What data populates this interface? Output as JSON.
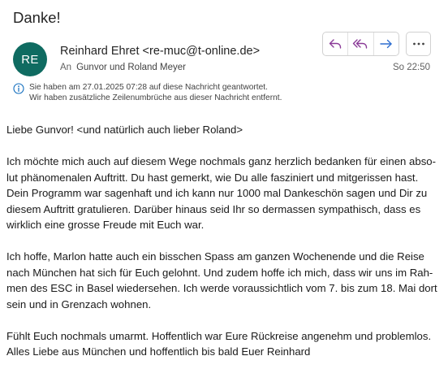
{
  "message": {
    "subject": "Danke!",
    "avatar_initials": "RE",
    "sender": "Reinhard Ehret <re-muc@t-online.de>",
    "to_label": "An",
    "recipients": "Gunvor und Roland Meyer",
    "time": "So 22:50",
    "info_lines": [
      "Sie haben am 27.01.2025 07:28 auf diese Nachricht geantwortet.",
      "Wir haben zusätzliche Zeilenumbrüche aus dieser Nachricht entfernt."
    ],
    "body_lines": [
      "Liebe Gunvor! <und natürlich auch lieber Roland>",
      "",
      "Ich möchte mich auch auf diesem Wege nochmals ganz herzlich bedanken für einen abso-",
      "lut phänomenalen Auftritt. Du hast gemerkt, wie Du alle fasziniert und mitgerissen hast.",
      "Dein Programm war sagenhaft und ich kann nur 1000 mal Dankeschön sagen und Dir zu",
      "diesem Auftritt gratulieren. Darüber hinaus seid Ihr so dermassen sympathisch, dass es",
      "wirklich eine grosse Freude mit Euch war.",
      "",
      "Ich hoffe, Marlon hatte auch ein bisschen Spass am ganzen Wochenende und die Reise",
      "nach München hat sich für Euch gelohnt. Und zudem hoffe ich mich, dass wir uns im Rah-",
      "men des ESC in Basel wiedersehen. Ich werde voraussichtlich vom 7. bis zum 18. Mai dort",
      "sein und in Grenzach wohnen.",
      "",
      "Fühlt Euch nochmals umarmt. Hoffentlich war Eure Rückreise angenehm und problemlos.",
      "Alles Liebe aus München und hoffentlich bis bald Euer Reinhard"
    ]
  },
  "actions": {
    "reply_icon": "reply-icon",
    "reply_all_icon": "reply-all-icon",
    "forward_icon": "forward-icon",
    "more_icon": "more-horizontal-icon"
  },
  "colors": {
    "avatar_bg": "#0f6b61",
    "reply_icon": "#8a3a97",
    "forward_icon": "#2f6fd0",
    "text": "#242424"
  }
}
